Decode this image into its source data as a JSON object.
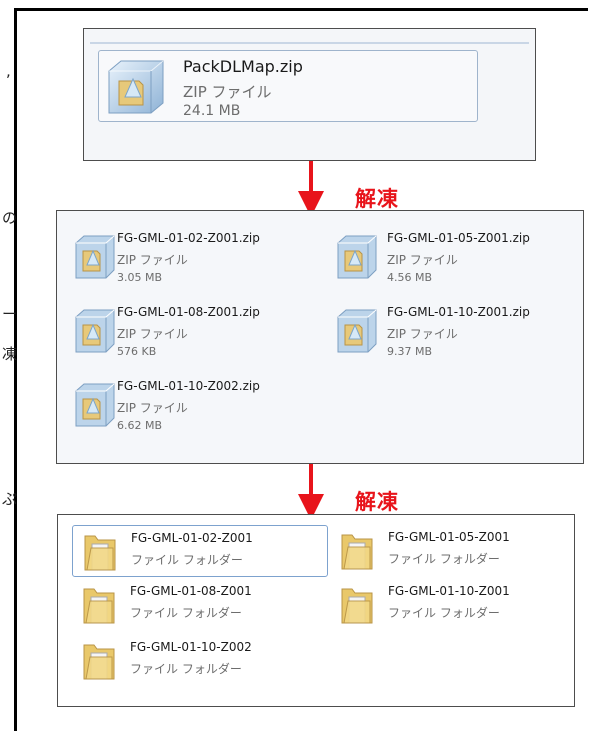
{
  "edge_fragments": [
    ",",
    "の",
    "ー",
    "凍",
    "ぷ"
  ],
  "source_file": {
    "name": "PackDLMap.zip",
    "type": "ZIP ファイル",
    "size": "24.1 MB"
  },
  "arrow1": {
    "label": "解凍"
  },
  "arrow2": {
    "label": "解凍"
  },
  "zip_files": [
    {
      "name": "FG-GML-01-02-Z001.zip",
      "type": "ZIP ファイル",
      "size": "3.05 MB"
    },
    {
      "name": "FG-GML-01-05-Z001.zip",
      "type": "ZIP ファイル",
      "size": "4.56 MB"
    },
    {
      "name": "FG-GML-01-08-Z001.zip",
      "type": "ZIP ファイル",
      "size": "576 KB"
    },
    {
      "name": "FG-GML-01-10-Z001.zip",
      "type": "ZIP ファイル",
      "size": "9.37 MB"
    },
    {
      "name": "FG-GML-01-10-Z002.zip",
      "type": "ZIP ファイル",
      "size": "6.62 MB"
    }
  ],
  "folders": [
    {
      "name": "FG-GML-01-02-Z001",
      "type": "ファイル フォルダー"
    },
    {
      "name": "FG-GML-01-05-Z001",
      "type": "ファイル フォルダー"
    },
    {
      "name": "FG-GML-01-08-Z001",
      "type": "ファイル フォルダー"
    },
    {
      "name": "FG-GML-01-10-Z001",
      "type": "ファイル フォルダー"
    },
    {
      "name": "FG-GML-01-10-Z002",
      "type": "ファイル フォルダー"
    }
  ],
  "colors": {
    "arrow": "#e8141b",
    "selection": "#7da2ce"
  },
  "icons": {
    "zip": "zip-archive-icon",
    "folder": "folder-icon",
    "arrow": "down-arrow-icon"
  }
}
